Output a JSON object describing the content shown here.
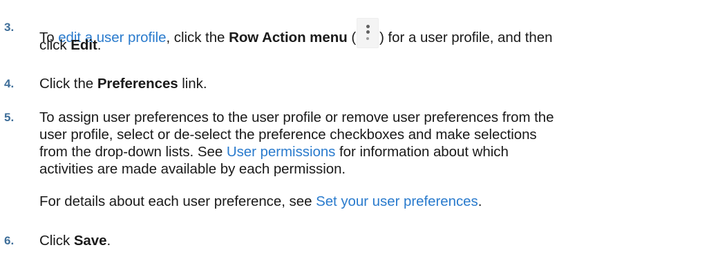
{
  "steps": [
    {
      "number": "3.",
      "parts": {
        "t1": "To ",
        "link": "edit a user profile",
        "t2": ", click the ",
        "b1": "Row Action menu",
        "t3": " (",
        "t4": ") for a user profile, and then",
        "t5": "click ",
        "b2": "Edit",
        "t6": "."
      }
    },
    {
      "number": "4.",
      "parts": {
        "t1": "Click the ",
        "b1": "Preferences",
        "t2": " link."
      }
    },
    {
      "number": "5.",
      "parts": {
        "line1": "To assign user preferences to the user profile or remove user preferences from the",
        "line2": "user profile, select or de-select the preference checkboxes and make selections",
        "line3a": "from the drop-down lists. See ",
        "link": "User permissions",
        "line3b": " for information about which",
        "line4": "activities are made available by each permission.",
        "note_a": "For details about each user preference, see ",
        "note_link": "Set your user preferences",
        "note_b": "."
      }
    },
    {
      "number": "6.",
      "parts": {
        "t1": "Click ",
        "b1": "Save",
        "t2": "."
      }
    }
  ],
  "icons": {
    "row_action": "vertical-ellipsis-icon"
  },
  "colors": {
    "number": "#3e6e99",
    "link": "#2a7bcd",
    "text": "#1a1a1a"
  }
}
